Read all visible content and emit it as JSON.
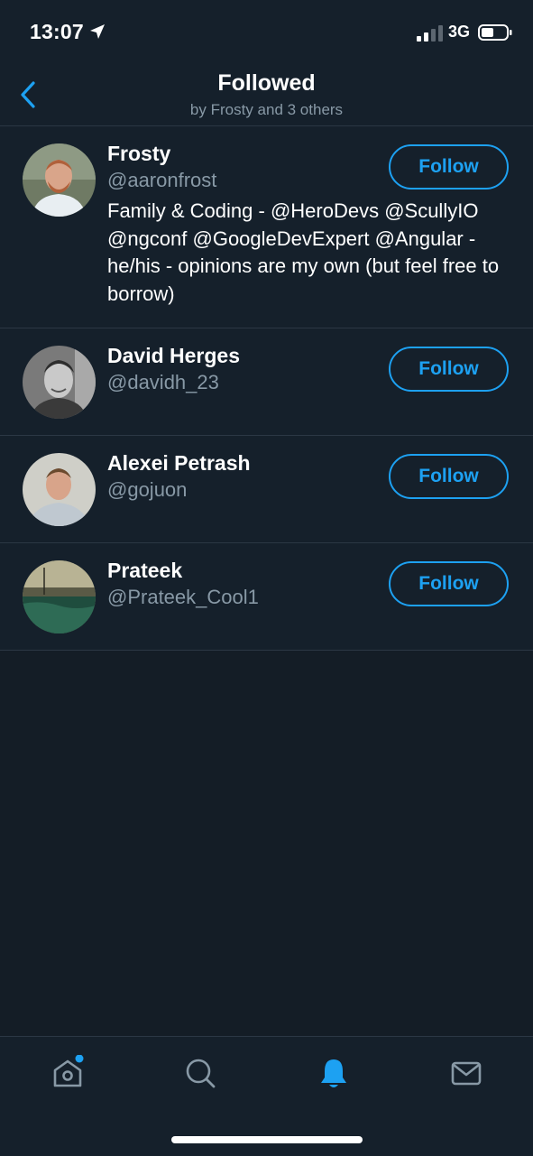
{
  "status_bar": {
    "time": "13:07",
    "network": "3G"
  },
  "header": {
    "title": "Followed",
    "subtitle": "by Frosty and 3 others"
  },
  "users": [
    {
      "name": "Frosty",
      "handle": "@aaronfrost",
      "bio": "Family & Coding - @HeroDevs @ScullyIO @ngconf @GoogleDevExpert @Angular - he/his - opinions are my own (but feel free to borrow)",
      "follow_label": "Follow"
    },
    {
      "name": "David Herges",
      "handle": "@davidh_23",
      "bio": "",
      "follow_label": "Follow"
    },
    {
      "name": "Alexei Petrash",
      "handle": "@gojuon",
      "bio": "",
      "follow_label": "Follow"
    },
    {
      "name": "Prateek",
      "handle": "@Prateek_Cool1",
      "bio": "",
      "follow_label": "Follow"
    }
  ],
  "tabs": [
    {
      "name": "home",
      "icon": "home-icon",
      "has_notification_dot": true
    },
    {
      "name": "search",
      "icon": "search-icon"
    },
    {
      "name": "notifications",
      "icon": "bell-icon",
      "active": true
    },
    {
      "name": "messages",
      "icon": "mail-icon"
    }
  ],
  "colors": {
    "accent": "#1da1f2",
    "background": "#15202b",
    "muted_text": "#8899a6",
    "divider": "#2b3744"
  }
}
